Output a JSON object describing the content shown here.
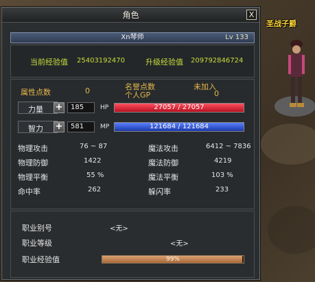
{
  "window": {
    "title": "角色",
    "close_label": "X"
  },
  "character": {
    "name": "Xn琴师",
    "level": "Lv 133"
  },
  "experience": {
    "current_label": "当前经验值",
    "current_value": "25403192470",
    "levelup_label": "升级经验值",
    "levelup_value": "209792846724"
  },
  "points": {
    "attr_label": "属性点数",
    "attr_value": "0",
    "fame_label": "名誉点数",
    "gp_label": "个人GP",
    "gp_value": "0",
    "guild_label": "未加入",
    "guild_value": "0"
  },
  "attributes": {
    "str_label": "力量",
    "str_value": "185",
    "hp_label": "HP",
    "hp_text": "27057 / 27057",
    "hp_fraction": 1.0,
    "int_label": "智力",
    "int_value": "581",
    "mp_label": "MP",
    "mp_text": "121684 / 121684",
    "mp_fraction": 1.0,
    "plus_label": "+"
  },
  "stats": {
    "phys_atk_label": "物理攻击",
    "phys_atk_value": "76 ~ 87",
    "mag_atk_label": "魔法攻击",
    "mag_atk_value": "6412 ~ 7836",
    "phys_def_label": "物理防御",
    "phys_def_value": "1422",
    "mag_def_label": "魔法防御",
    "mag_def_value": "4219",
    "phys_bal_label": "物理平衡",
    "phys_bal_value": "55 %",
    "mag_bal_label": "魔法平衡",
    "mag_bal_value": "103 %",
    "hit_label": "命中率",
    "hit_value": "262",
    "dodge_label": "躲闪率",
    "dodge_value": "233"
  },
  "job": {
    "alias_label": "职业别号",
    "alias_value": "<无>",
    "grade_label": "职业等级",
    "grade_value": "<无>",
    "exp_label": "职业经验值",
    "exp_text": "99%",
    "exp_fraction": 0.99
  },
  "world": {
    "npc_name": "圣战子爵"
  },
  "colors": {
    "hp_bar": "#d42030",
    "mp_bar": "#2a50c8",
    "accent_green": "#c8dc3a",
    "accent_gold": "#e8b84a"
  }
}
